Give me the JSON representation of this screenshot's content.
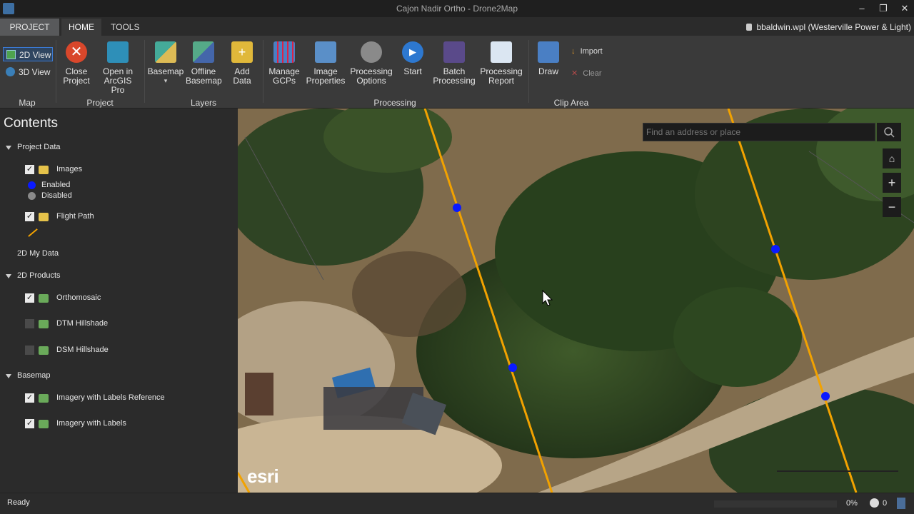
{
  "window": {
    "title": "Cajon Nadir Ortho - Drone2Map"
  },
  "tabs": {
    "project": "PROJECT",
    "home": "HOME",
    "tools": "TOOLS"
  },
  "user": {
    "label": "bbaldwin.wpl (Westerville Power & Light)"
  },
  "ribbon": {
    "map": {
      "view2d": "2D View",
      "view3d": "3D View",
      "group": "Map"
    },
    "project": {
      "close": "Close Project",
      "arcgis": "Open in ArcGIS Pro",
      "group": "Project"
    },
    "layers": {
      "basemap": "Basemap",
      "offline": "Offline Basemap",
      "add_data": "Add Data",
      "group": "Layers"
    },
    "processing": {
      "gcps": "Manage GCPs",
      "image_props": "Image Properties",
      "options": "Processing Options",
      "start": "Start",
      "batch": "Batch Processing",
      "report": "Processing Report",
      "group": "Processing"
    },
    "clip": {
      "draw": "Draw",
      "import": "Import",
      "clear": "Clear",
      "group": "Clip Area"
    }
  },
  "contents": {
    "title": "Contents",
    "project_data": "Project Data",
    "images": "Images",
    "enabled": "Enabled",
    "disabled": "Disabled",
    "flight_path": "Flight Path",
    "my_data": "2D My Data",
    "products": "2D Products",
    "ortho": "Orthomosaic",
    "dtm": "DTM Hillshade",
    "dsm": "DSM Hillshade",
    "basemap": "Basemap",
    "labels_ref": "Imagery with Labels Reference",
    "labels": "Imagery with Labels"
  },
  "map": {
    "search_placeholder": "Find an address or place",
    "attribution": "esri"
  },
  "status": {
    "ready": "Ready",
    "percent": "0%",
    "count": "0"
  },
  "colors": {
    "accent": "#3b7bd6",
    "flight_path": "#f2a200",
    "image_point": "#0a1aff"
  }
}
